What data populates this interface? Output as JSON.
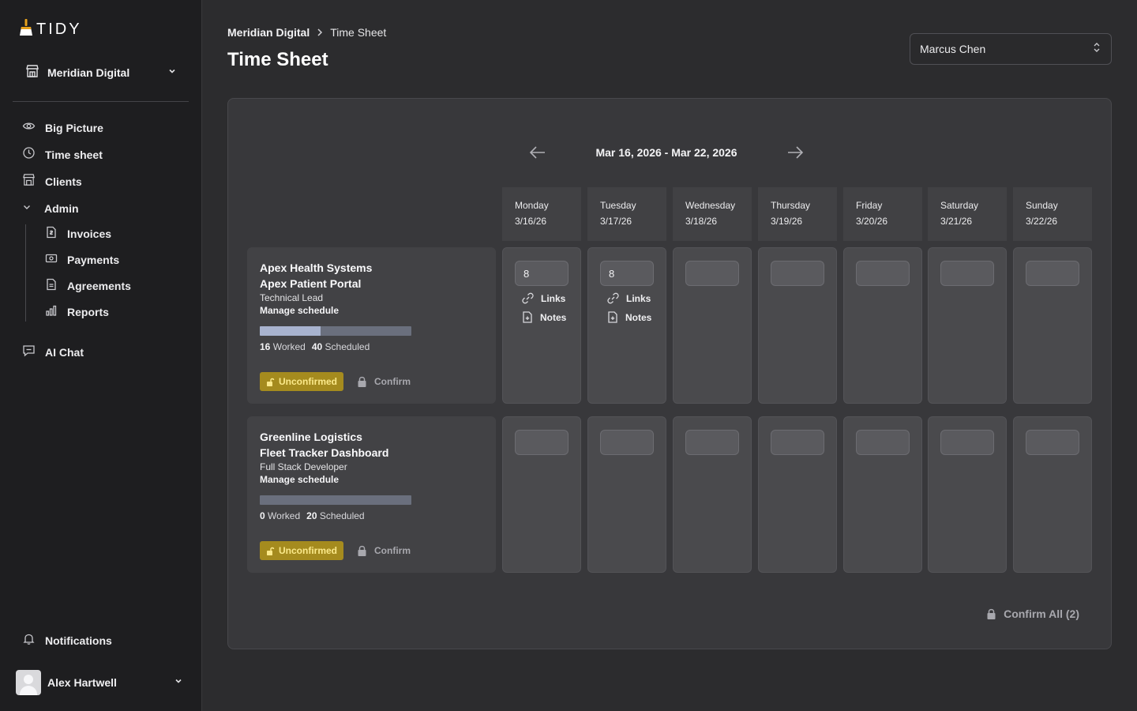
{
  "app": {
    "logo_text": "TIDY"
  },
  "sidebar": {
    "org": "Meridian Digital",
    "nav": [
      {
        "label": "Big Picture",
        "icon": "eye-icon"
      },
      {
        "label": "Time sheet",
        "icon": "clock-icon"
      },
      {
        "label": "Clients",
        "icon": "building-icon"
      }
    ],
    "admin": {
      "label": "Admin",
      "items": [
        {
          "label": "Invoices",
          "icon": "invoice-icon"
        },
        {
          "label": "Payments",
          "icon": "payment-icon"
        },
        {
          "label": "Agreements",
          "icon": "document-icon"
        },
        {
          "label": "Reports",
          "icon": "bar-chart-icon"
        }
      ]
    },
    "ai_chat": "AI Chat",
    "notifications": "Notifications",
    "user": "Alex Hartwell"
  },
  "header": {
    "breadcrumb": [
      "Meridian Digital",
      "Time Sheet"
    ],
    "title": "Time Sheet",
    "person": "Marcus Chen"
  },
  "timesheet": {
    "week_range": "Mar 16, 2026 - Mar 22, 2026",
    "days": [
      {
        "name": "Monday",
        "date": "3/16/26"
      },
      {
        "name": "Tuesday",
        "date": "3/17/26"
      },
      {
        "name": "Wednesday",
        "date": "3/18/26"
      },
      {
        "name": "Thursday",
        "date": "3/19/26"
      },
      {
        "name": "Friday",
        "date": "3/20/26"
      },
      {
        "name": "Saturday",
        "date": "3/21/26"
      },
      {
        "name": "Sunday",
        "date": "3/22/26"
      }
    ],
    "links_label": "Links",
    "notes_label": "Notes",
    "rows": [
      {
        "client": "Apex Health Systems",
        "project": "Apex Patient Portal",
        "role": "Technical Lead",
        "manage": "Manage schedule",
        "worked": "16",
        "worked_label": "Worked",
        "scheduled": "40",
        "scheduled_label": "Scheduled",
        "progress_fraction": 0.4,
        "status": "Unconfirmed",
        "confirm": "Confirm",
        "hours": [
          "8",
          "8",
          "",
          "",
          "",
          "",
          ""
        ]
      },
      {
        "client": "Greenline Logistics",
        "project": "Fleet Tracker Dashboard",
        "role": "Full Stack Developer",
        "manage": "Manage schedule",
        "worked": "0",
        "worked_label": "Worked",
        "scheduled": "20",
        "scheduled_label": "Scheduled",
        "progress_fraction": 0,
        "status": "Unconfirmed",
        "confirm": "Confirm",
        "hours": [
          "",
          "",
          "",
          "",
          "",
          "",
          ""
        ]
      }
    ],
    "confirm_all": "Confirm All (2)"
  },
  "colors": {
    "badge_bg": "#a58b1e",
    "badge_text": "#fbe98a",
    "progress_fill": "#a8b3cf",
    "progress_track": "#6a6f7d"
  }
}
